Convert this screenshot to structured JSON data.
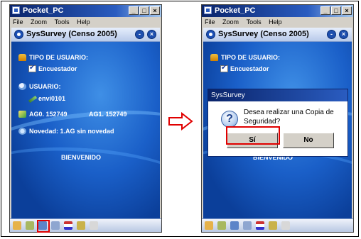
{
  "window": {
    "title": "Pocket_PC",
    "controls": [
      "_",
      "□",
      "×"
    ],
    "menu": [
      "File",
      "Zoom",
      "Tools",
      "Help"
    ]
  },
  "app": {
    "title": "SysSurvey (Censo 2005)",
    "header_buttons": [
      "-",
      "×"
    ]
  },
  "fields": {
    "tipo_label": "TIPO DE USUARIO:",
    "tipo_value": "Encuestador",
    "usuario_label": "USUARIO:",
    "usuario_value": "envi0101",
    "ag0": "AG0. 152749",
    "ag1": "AG1. 152749",
    "novedad": "Novedad: 1.AG sin novedad",
    "bienvenido": "BIENVENIDO"
  },
  "dialog": {
    "title": "SysSurvey",
    "message": "Desea realizar una Copia de Seguridad?",
    "yes": "Sí",
    "no": "No"
  },
  "taskbar": {
    "icons": [
      "folder-icon",
      "map-icon",
      "backup-icon",
      "sync-icon",
      "flag-icon",
      "pencil-icon",
      "warning-icon"
    ]
  },
  "colors": {
    "highlight": "#e00000",
    "arrow": "#e00000",
    "title_blue": "#0a246a"
  }
}
